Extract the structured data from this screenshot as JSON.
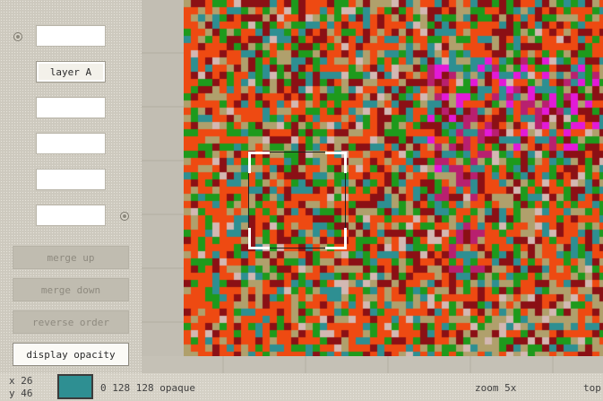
{
  "layer_panel": {
    "slots": [
      {
        "label": ""
      },
      {
        "label": "layer A"
      },
      {
        "label": ""
      },
      {
        "label": ""
      },
      {
        "label": ""
      },
      {
        "label": ""
      }
    ],
    "buttons": [
      {
        "label": "merge up",
        "active": false
      },
      {
        "label": "merge down",
        "active": false
      },
      {
        "label": "reverse order",
        "active": false
      },
      {
        "label": "display opacity",
        "active": true
      }
    ]
  },
  "canvas": {
    "palette": [
      "#ee4a12",
      "#8b1015",
      "#1e9a1c",
      "#2e8f92",
      "#b0a06c",
      "#d3b8b3",
      "#e21ad8",
      "#b8206f"
    ]
  },
  "status_bar": {
    "x_label": "x",
    "x_value": "26",
    "y_label": "y",
    "y_value": "46",
    "color_swatch": "#2e8f92",
    "color_values": "0 128 128 opaque",
    "zoom": "zoom 5x",
    "truncated_text": "top"
  }
}
